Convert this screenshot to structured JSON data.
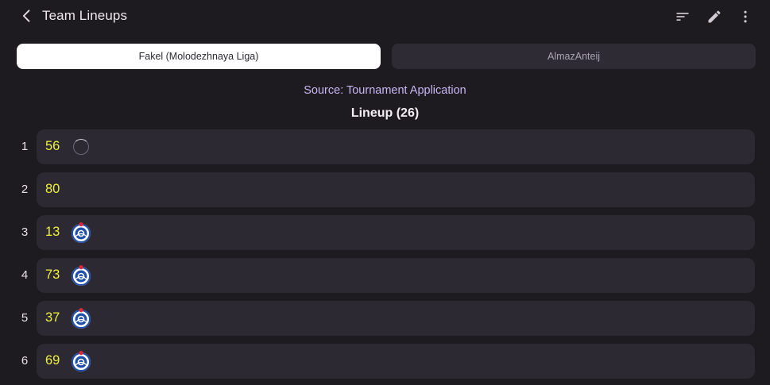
{
  "header": {
    "title": "Team Lineups"
  },
  "tabs": [
    {
      "label": "Fakel (Molodezhnaya Liga)",
      "active": true
    },
    {
      "label": "AlmazAnteij",
      "active": false
    }
  ],
  "source_text": "Source: Tournament Application",
  "lineup_heading": "Lineup (26)",
  "colors": {
    "background": "#1d1b20",
    "card": "#2c2932",
    "number": "#eef03a",
    "source": "#c6b7f2"
  },
  "rows": [
    {
      "index": "1",
      "number": "56",
      "logo": "loading-spinner"
    },
    {
      "index": "2",
      "number": "80",
      "logo": "none"
    },
    {
      "index": "3",
      "number": "13",
      "logo": "team-logo"
    },
    {
      "index": "4",
      "number": "73",
      "logo": "team-logo"
    },
    {
      "index": "5",
      "number": "37",
      "logo": "team-logo"
    },
    {
      "index": "6",
      "number": "69",
      "logo": "team-logo"
    }
  ]
}
